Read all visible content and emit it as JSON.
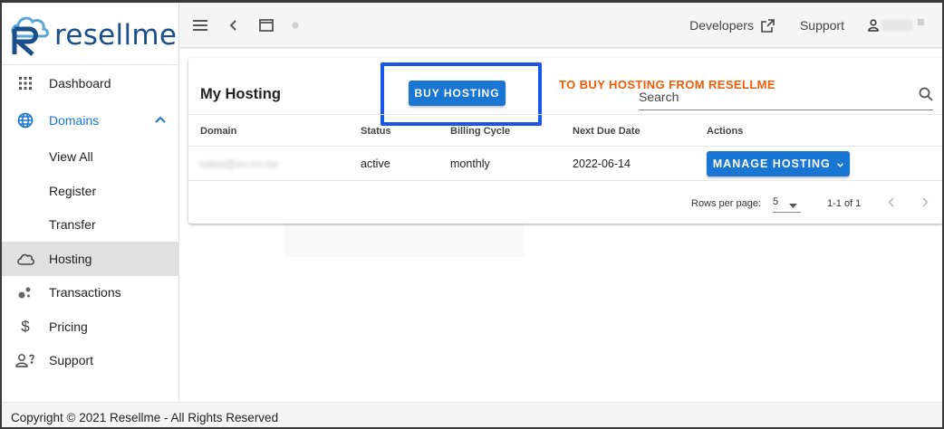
{
  "brand": {
    "name": "resellme",
    "color": "#1a4f8b",
    "accent": "#1976d2"
  },
  "sidebar": {
    "items": [
      {
        "label": "Dashboard",
        "icon": "grid-icon"
      },
      {
        "label": "Domains",
        "icon": "globe-icon"
      },
      {
        "label": "View All"
      },
      {
        "label": "Register"
      },
      {
        "label": "Transfer"
      },
      {
        "label": "Hosting",
        "icon": "cloud-icon"
      },
      {
        "label": "Transactions",
        "icon": "bubbles-icon"
      },
      {
        "label": "Pricing",
        "icon": "dollar-icon"
      },
      {
        "label": "Support",
        "icon": "person-help-icon"
      }
    ]
  },
  "topbar": {
    "developers_label": "Developers",
    "support_label": "Support"
  },
  "card": {
    "title": "My Hosting",
    "buy_label": "BUY HOSTING",
    "annotation": "TO BUY HOSTING FROM RESELLME",
    "search_placeholder": "Search"
  },
  "table": {
    "columns": [
      "Domain",
      "Status",
      "Billing Cycle",
      "Next Due Date",
      "Actions"
    ],
    "rows": [
      {
        "domain": "sales@ex.co.zw",
        "status": "active",
        "billing": "monthly",
        "due": "2022-06-14",
        "action": "MANAGE HOSTING"
      }
    ]
  },
  "pagination": {
    "rows_per_page_label": "Rows per page:",
    "rows_per_page_value": "5",
    "range": "1-1 of 1"
  },
  "footer": {
    "text": "Copyright © 2021 Resellme - All Rights Reserved"
  },
  "colors": {
    "annotation": "#f25c05",
    "highlight_box": "#1a56e8",
    "active_nav_bg": "#e0e0e0"
  }
}
